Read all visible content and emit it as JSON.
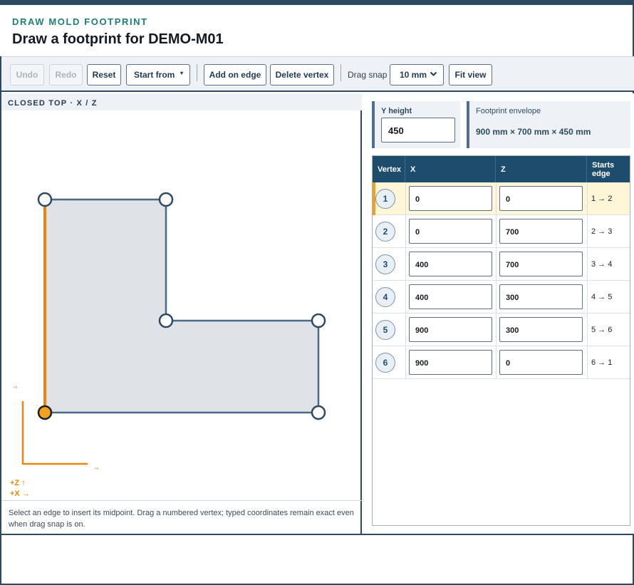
{
  "header": {
    "eyebrow": "DRAW MOLD FOOTPRINT",
    "title": "Draw a footprint for DEMO-M01"
  },
  "toolbar": {
    "undo_label": "Undo",
    "redo_label": "Redo",
    "reset_label": "Reset",
    "start_from_label": "Start from",
    "add_on_edge_label": "Add on edge",
    "delete_vertex_label": "Delete vertex",
    "drag_snap_label": "Drag snap",
    "drag_snap_value": "10 mm",
    "fit_view_label": "Fit view"
  },
  "canvas": {
    "label": "CLOSED TOP · X / Z",
    "axis_z": "+Z ↑",
    "axis_x": "+X →",
    "axis_tick_z": "+z",
    "axis_tick_x": "+x",
    "hint": "Select an edge to insert its midpoint. Drag a numbered vertex; typed coordinates remain exact even when drag snap is on.",
    "selected_vertex": 1,
    "highlight_edge_color": "#e8870f",
    "shape_fill": "#dfe3e7",
    "shape_stroke": "#4a6a87"
  },
  "y_height": {
    "label": "Y height",
    "value": "450"
  },
  "envelope": {
    "label": "Footprint envelope",
    "value": "900 mm × 700 mm × 450 mm"
  },
  "table": {
    "headers": [
      "Vertex",
      "X",
      "Z",
      "Starts edge"
    ],
    "rows": [
      {
        "vertex": "1",
        "x": "0",
        "z": "0",
        "edge": "1 → 2"
      },
      {
        "vertex": "2",
        "x": "0",
        "z": "700",
        "edge": "2 → 3"
      },
      {
        "vertex": "3",
        "x": "400",
        "z": "700",
        "edge": "3 → 4"
      },
      {
        "vertex": "4",
        "x": "400",
        "z": "300",
        "edge": "4 → 5"
      },
      {
        "vertex": "5",
        "x": "900",
        "z": "300",
        "edge": "5 → 6"
      },
      {
        "vertex": "6",
        "x": "900",
        "z": "0",
        "edge": "6 → 1"
      }
    ]
  }
}
